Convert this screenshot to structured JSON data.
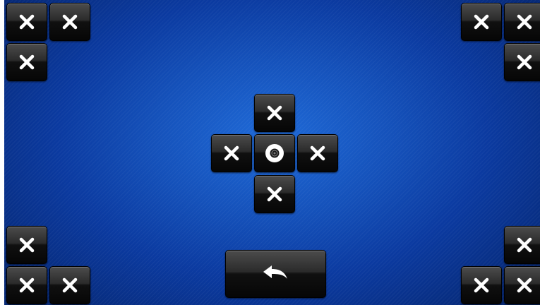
{
  "controls": {
    "corner_buttons": [
      {
        "name": "top-left-close-button-1",
        "icon": "x-icon"
      },
      {
        "name": "top-left-close-button-2",
        "icon": "x-icon"
      },
      {
        "name": "top-left-close-button-3",
        "icon": "x-icon"
      },
      {
        "name": "top-right-close-button-1",
        "icon": "x-icon"
      },
      {
        "name": "top-right-close-button-2",
        "icon": "x-icon"
      },
      {
        "name": "top-right-close-button-3",
        "icon": "x-icon"
      },
      {
        "name": "bottom-left-close-button-1",
        "icon": "x-icon"
      },
      {
        "name": "bottom-left-close-button-2",
        "icon": "x-icon"
      },
      {
        "name": "bottom-left-close-button-3",
        "icon": "x-icon"
      },
      {
        "name": "bottom-right-close-button-1",
        "icon": "x-icon"
      },
      {
        "name": "bottom-right-close-button-2",
        "icon": "x-icon"
      },
      {
        "name": "bottom-right-close-button-3",
        "icon": "x-icon"
      }
    ],
    "dpad": {
      "up": {
        "icon": "x-icon"
      },
      "left": {
        "icon": "x-icon"
      },
      "center": {
        "icon": "target-icon"
      },
      "right": {
        "icon": "x-icon"
      },
      "down": {
        "icon": "x-icon"
      }
    },
    "back_button": {
      "icon": "back-arrow-icon"
    }
  },
  "colors": {
    "background_center": "#1f6ad8",
    "background_edge": "#072a78",
    "button_dark": "#060606",
    "icon_white": "#ffffff"
  }
}
